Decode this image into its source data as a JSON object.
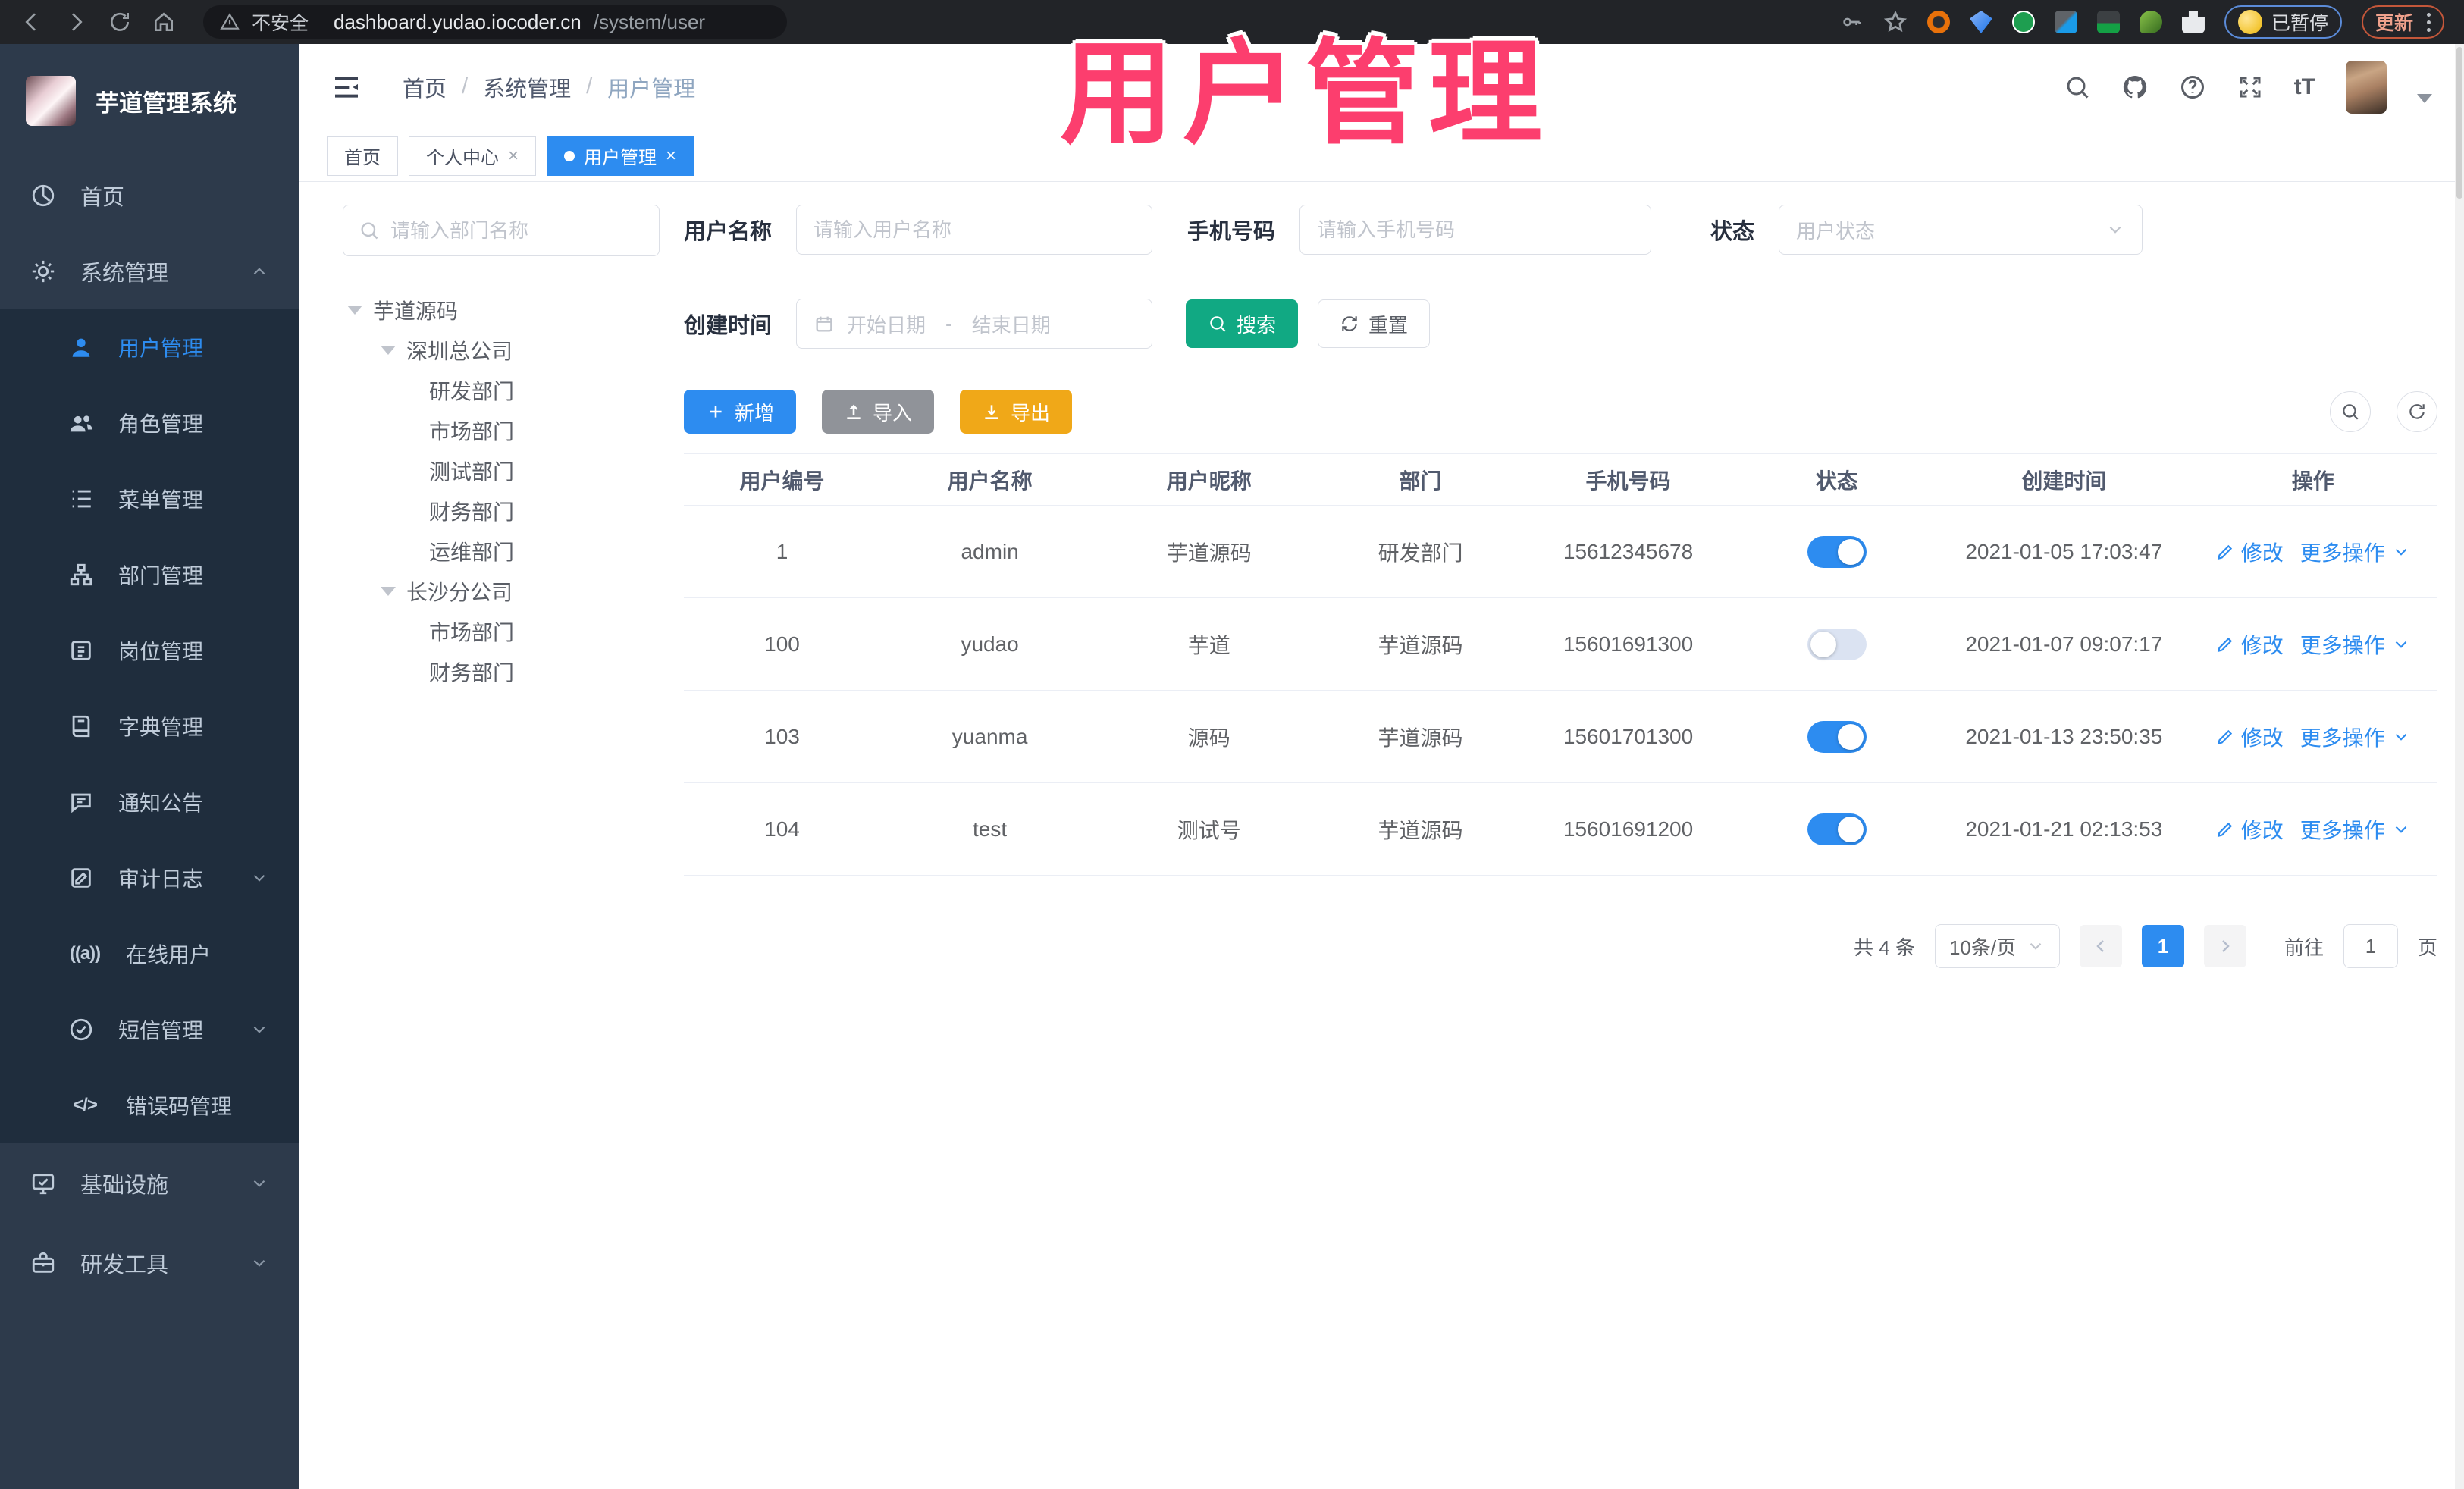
{
  "browser": {
    "security_label": "不安全",
    "url_host": "dashboard.yudao.iocoder.cn",
    "url_path": "/system/user",
    "paused_badge": "已暂停",
    "update_label": "更新"
  },
  "overlay": {
    "text": "用户管理",
    "color": "#fc3e6e"
  },
  "sidebar": {
    "title": "芋道管理系统",
    "home": "首页",
    "system": "系统管理",
    "submenu": [
      "用户管理",
      "角色管理",
      "菜单管理",
      "部门管理",
      "岗位管理",
      "字典管理",
      "通知公告",
      "审计日志",
      "在线用户",
      "短信管理",
      "错误码管理"
    ],
    "infra": "基础设施",
    "devtool": "研发工具"
  },
  "header": {
    "breadcrumb": [
      "首页",
      "系统管理",
      "用户管理"
    ],
    "separator": "/"
  },
  "tabs": {
    "home": "首页",
    "profile": "个人中心",
    "user": "用户管理"
  },
  "dept": {
    "placeholder": "请输入部门名称",
    "tree": [
      "芋道源码",
      "深圳总公司",
      "研发部门",
      "市场部门",
      "测试部门",
      "财务部门",
      "运维部门",
      "长沙分公司",
      "市场部门",
      "财务部门"
    ]
  },
  "filters": {
    "username_label": "用户名称",
    "username_placeholder": "请输入用户名称",
    "mobile_label": "手机号码",
    "mobile_placeholder": "请输入手机号码",
    "status_label": "状态",
    "status_placeholder": "用户状态",
    "createtime_label": "创建时间",
    "date_start": "开始日期",
    "date_separator": "-",
    "date_end": "结束日期",
    "search": "搜索",
    "reset": "重置"
  },
  "toolbar": {
    "add": "新增",
    "import": "导入",
    "export": "导出"
  },
  "table": {
    "columns": [
      "用户编号",
      "用户名称",
      "用户昵称",
      "部门",
      "手机号码",
      "状态",
      "创建时间",
      "操作"
    ],
    "actions": {
      "edit": "修改",
      "more": "更多操作"
    },
    "rows": [
      {
        "id": "1",
        "username": "admin",
        "nickname": "芋道源码",
        "dept": "研发部门",
        "mobile": "15612345678",
        "status": true,
        "created": "2021-01-05 17:03:47"
      },
      {
        "id": "100",
        "username": "yudao",
        "nickname": "芋道",
        "dept": "芋道源码",
        "mobile": "15601691300",
        "status": false,
        "created": "2021-01-07 09:07:17"
      },
      {
        "id": "103",
        "username": "yuanma",
        "nickname": "源码",
        "dept": "芋道源码",
        "mobile": "15601701300",
        "status": true,
        "created": "2021-01-13 23:50:35"
      },
      {
        "id": "104",
        "username": "test",
        "nickname": "测试号",
        "dept": "芋道源码",
        "mobile": "15601691200",
        "status": true,
        "created": "2021-01-21 02:13:53"
      }
    ]
  },
  "pagination": {
    "total": "共 4 条",
    "size": "10条/页",
    "page": "1",
    "goto": "前往",
    "unit": "页",
    "goto_value": "1"
  },
  "colors": {
    "primary": "#2d8cf0",
    "teal": "#11a983",
    "amber": "#f0a818",
    "gray_button": "#909399",
    "pink": "#fc3e6e",
    "sidebar_bg": "#2d3a4b",
    "submenu_bg": "#1f2d3d"
  }
}
